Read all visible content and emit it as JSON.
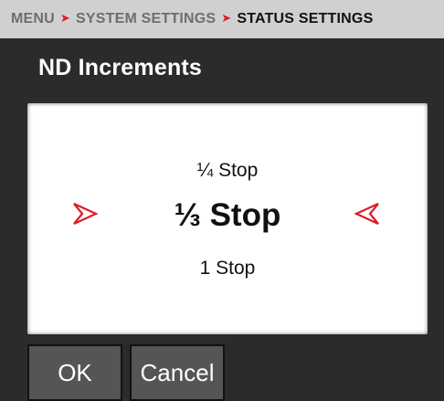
{
  "breadcrumb": {
    "items": [
      "MENU",
      "SYSTEM SETTINGS",
      "STATUS SETTINGS"
    ],
    "separator": "➤"
  },
  "page": {
    "title": "ND Increments"
  },
  "picker": {
    "previous_option": "¼ Stop",
    "selected_option": "⅓ Stop",
    "next_option": "1 Stop",
    "arrow_color": "#e01b24"
  },
  "buttons": {
    "ok_label": "OK",
    "cancel_label": "Cancel"
  },
  "colors": {
    "accent": "#e01b24",
    "background": "#2b2b2b",
    "breadcrumb_bg": "#d0d0d0",
    "button_bg": "#555555"
  }
}
